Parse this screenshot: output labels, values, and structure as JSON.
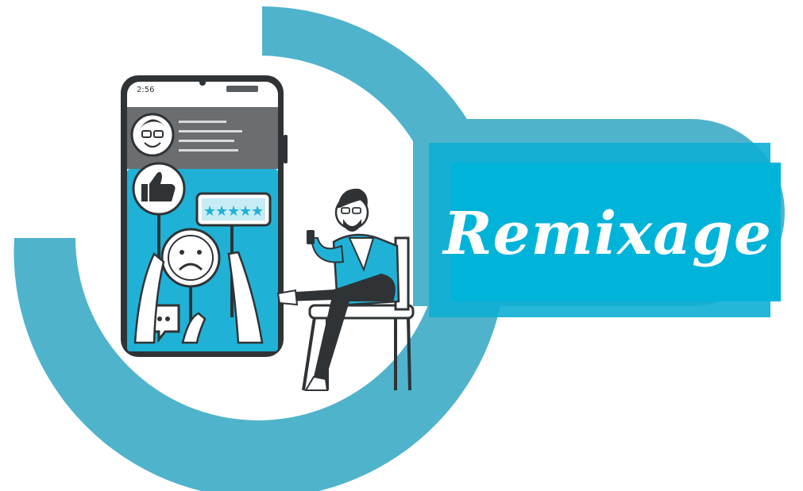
{
  "phone": {
    "status_time": "2:56",
    "rating_stars": 5
  },
  "brand": {
    "name": "Remixage"
  },
  "colors": {
    "accent_ring": "#4fb3cc",
    "banner": "#00b3d9",
    "phone_screen": "#1fb2d6",
    "dark": "#2f3336",
    "grey_header": "#6b6e70"
  },
  "icons": [
    "thumbs-up-icon",
    "rating-stars-icon",
    "sad-face-icon",
    "chat-bubble-icon",
    "avatar-icon",
    "phone-icon"
  ]
}
